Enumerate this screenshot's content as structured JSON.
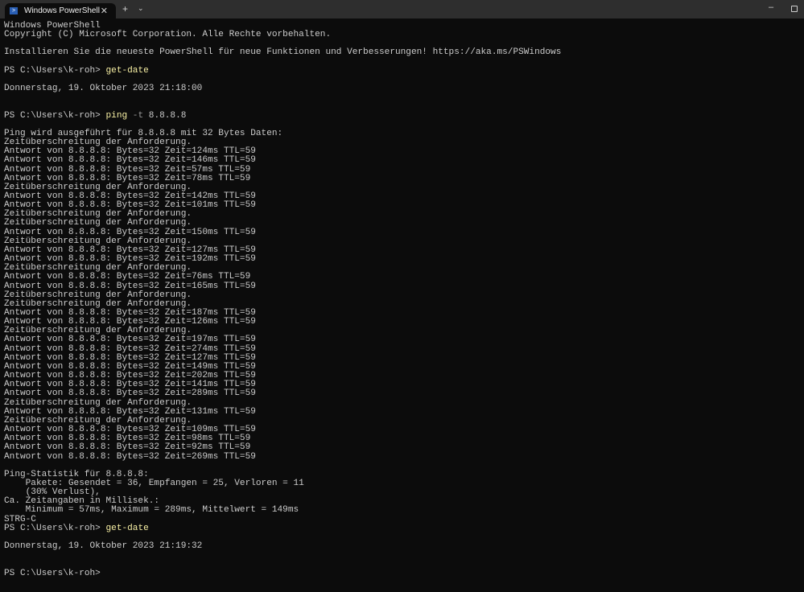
{
  "window": {
    "tab_title": "Windows PowerShell",
    "tab_icon": "powershell-icon",
    "new_tab": "+",
    "dropdown": "⌄",
    "close": "✕",
    "minimize": "–"
  },
  "colors": {
    "background": "#0c0c0c",
    "text": "#cccccc",
    "command": "#f9f1a5"
  },
  "terminal": {
    "lines": [
      {
        "text": "Windows PowerShell"
      },
      {
        "text": "Copyright (C) Microsoft Corporation. Alle Rechte vorbehalten."
      },
      {
        "text": ""
      },
      {
        "text": "Installieren Sie die neueste PowerShell für neue Funktionen und Verbesserungen! https://aka.ms/PSWindows"
      },
      {
        "text": ""
      },
      {
        "prompt": "PS C:\\Users\\k-roh> ",
        "cmd": "get-date"
      },
      {
        "text": ""
      },
      {
        "text": "Donnerstag, 19. Oktober 2023 21:18:00"
      },
      {
        "text": ""
      },
      {
        "text": ""
      },
      {
        "prompt": "PS C:\\Users\\k-roh> ",
        "cmd": "ping",
        "flag": " -t",
        "args": " 8.8.8.8"
      },
      {
        "text": ""
      },
      {
        "text": "Ping wird ausgeführt für 8.8.8.8 mit 32 Bytes Daten:"
      },
      {
        "text": "Zeitüberschreitung der Anforderung."
      },
      {
        "text": "Antwort von 8.8.8.8: Bytes=32 Zeit=124ms TTL=59"
      },
      {
        "text": "Antwort von 8.8.8.8: Bytes=32 Zeit=146ms TTL=59"
      },
      {
        "text": "Antwort von 8.8.8.8: Bytes=32 Zeit=57ms TTL=59"
      },
      {
        "text": "Antwort von 8.8.8.8: Bytes=32 Zeit=78ms TTL=59"
      },
      {
        "text": "Zeitüberschreitung der Anforderung."
      },
      {
        "text": "Antwort von 8.8.8.8: Bytes=32 Zeit=142ms TTL=59"
      },
      {
        "text": "Antwort von 8.8.8.8: Bytes=32 Zeit=101ms TTL=59"
      },
      {
        "text": "Zeitüberschreitung der Anforderung."
      },
      {
        "text": "Zeitüberschreitung der Anforderung."
      },
      {
        "text": "Antwort von 8.8.8.8: Bytes=32 Zeit=150ms TTL=59"
      },
      {
        "text": "Zeitüberschreitung der Anforderung."
      },
      {
        "text": "Antwort von 8.8.8.8: Bytes=32 Zeit=127ms TTL=59"
      },
      {
        "text": "Antwort von 8.8.8.8: Bytes=32 Zeit=192ms TTL=59"
      },
      {
        "text": "Zeitüberschreitung der Anforderung."
      },
      {
        "text": "Antwort von 8.8.8.8: Bytes=32 Zeit=76ms TTL=59"
      },
      {
        "text": "Antwort von 8.8.8.8: Bytes=32 Zeit=165ms TTL=59"
      },
      {
        "text": "Zeitüberschreitung der Anforderung."
      },
      {
        "text": "Zeitüberschreitung der Anforderung."
      },
      {
        "text": "Antwort von 8.8.8.8: Bytes=32 Zeit=187ms TTL=59"
      },
      {
        "text": "Antwort von 8.8.8.8: Bytes=32 Zeit=126ms TTL=59"
      },
      {
        "text": "Zeitüberschreitung der Anforderung."
      },
      {
        "text": "Antwort von 8.8.8.8: Bytes=32 Zeit=197ms TTL=59"
      },
      {
        "text": "Antwort von 8.8.8.8: Bytes=32 Zeit=274ms TTL=59"
      },
      {
        "text": "Antwort von 8.8.8.8: Bytes=32 Zeit=127ms TTL=59"
      },
      {
        "text": "Antwort von 8.8.8.8: Bytes=32 Zeit=149ms TTL=59"
      },
      {
        "text": "Antwort von 8.8.8.8: Bytes=32 Zeit=202ms TTL=59"
      },
      {
        "text": "Antwort von 8.8.8.8: Bytes=32 Zeit=141ms TTL=59"
      },
      {
        "text": "Antwort von 8.8.8.8: Bytes=32 Zeit=289ms TTL=59"
      },
      {
        "text": "Zeitüberschreitung der Anforderung."
      },
      {
        "text": "Antwort von 8.8.8.8: Bytes=32 Zeit=131ms TTL=59"
      },
      {
        "text": "Zeitüberschreitung der Anforderung."
      },
      {
        "text": "Antwort von 8.8.8.8: Bytes=32 Zeit=109ms TTL=59"
      },
      {
        "text": "Antwort von 8.8.8.8: Bytes=32 Zeit=98ms TTL=59"
      },
      {
        "text": "Antwort von 8.8.8.8: Bytes=32 Zeit=92ms TTL=59"
      },
      {
        "text": "Antwort von 8.8.8.8: Bytes=32 Zeit=269ms TTL=59"
      },
      {
        "text": ""
      },
      {
        "text": "Ping-Statistik für 8.8.8.8:"
      },
      {
        "text": "    Pakete: Gesendet = 36, Empfangen = 25, Verloren = 11"
      },
      {
        "text": "    (30% Verlust),"
      },
      {
        "text": "Ca. Zeitangaben in Millisek.:"
      },
      {
        "text": "    Minimum = 57ms, Maximum = 289ms, Mittelwert = 149ms"
      },
      {
        "text": "STRG-C"
      },
      {
        "prompt": "PS C:\\Users\\k-roh> ",
        "cmd": "get-date"
      },
      {
        "text": ""
      },
      {
        "text": "Donnerstag, 19. Oktober 2023 21:19:32"
      },
      {
        "text": ""
      },
      {
        "text": ""
      },
      {
        "prompt": "PS C:\\Users\\k-roh> "
      }
    ]
  }
}
